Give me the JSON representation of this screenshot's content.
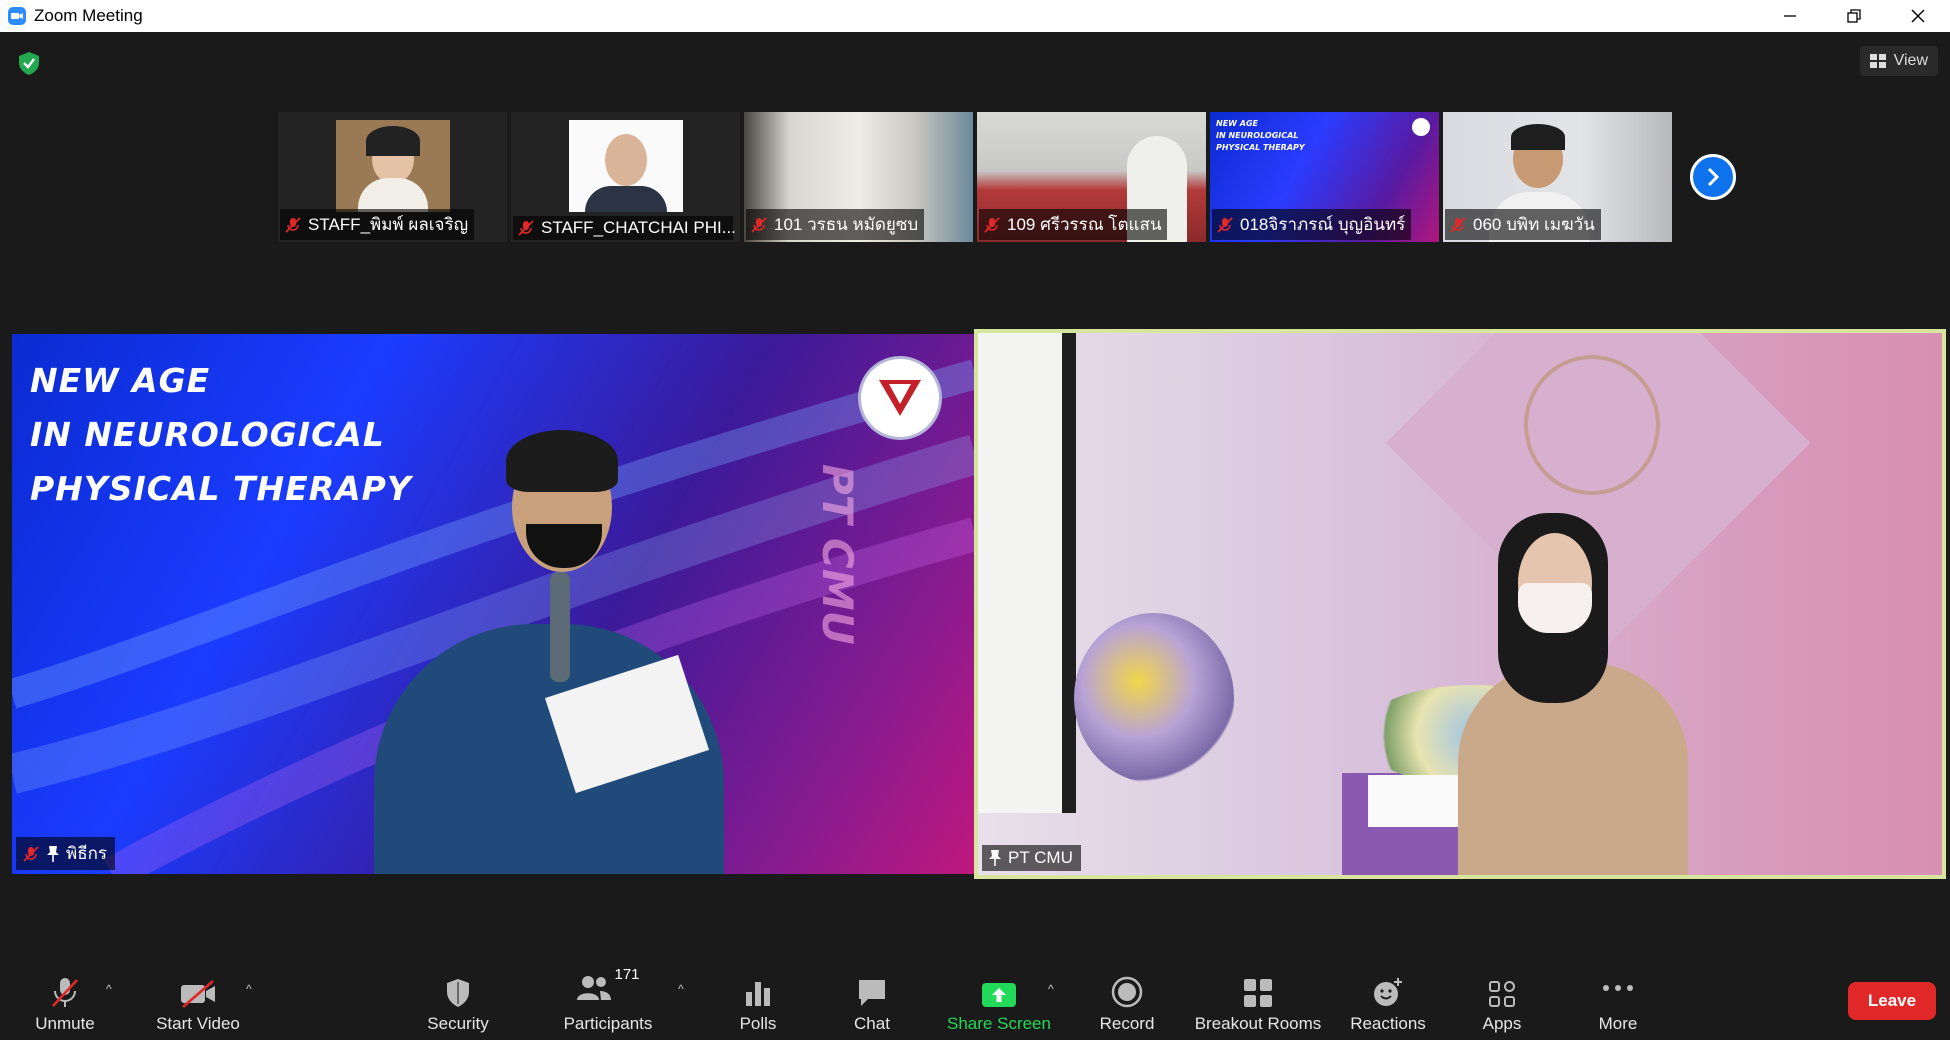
{
  "window": {
    "title": "Zoom Meeting"
  },
  "topbar": {
    "view_label": "View"
  },
  "thumbnails": [
    {
      "name": "STAFF_พิมพ์ ผลเจริญ",
      "muted": true,
      "bg": "#2a2a2a"
    },
    {
      "name": "STAFF_CHATCHAI PHI...",
      "muted": true,
      "bg": "#2a2a2a"
    },
    {
      "name": "101 วรธน หมัดยูซบ",
      "muted": true,
      "bg": "#8c8880"
    },
    {
      "name": "109 ศรีวรรณ โตแสน",
      "muted": true,
      "bg": "#a79a8a"
    },
    {
      "name": "018จิราภรณ์ บุญอินทร์",
      "muted": true,
      "bg": "#1b1f9c"
    },
    {
      "name": "060 บพิท เมฆวัน",
      "muted": true,
      "bg": "#d9dadf"
    }
  ],
  "main": {
    "left": {
      "name": "พิธีกร",
      "slide_lines": [
        "NEW AGE",
        "IN NEUROLOGICAL",
        "PHYSICAL THERAPY"
      ],
      "slide_side_text": "PT CMU"
    },
    "right": {
      "name": "PT CMU"
    }
  },
  "toolbar": {
    "unmute": "Unmute",
    "start_video": "Start Video",
    "security": "Security",
    "participants": "Participants",
    "participants_count": "171",
    "polls": "Polls",
    "chat": "Chat",
    "share_screen": "Share Screen",
    "record": "Record",
    "breakout_rooms": "Breakout Rooms",
    "reactions": "Reactions",
    "apps": "Apps",
    "more": "More",
    "leave": "Leave"
  },
  "colors": {
    "share_screen_green": "#23d959",
    "leave_red": "#e02828",
    "active_speaker_border": "#d8e59c",
    "next_arrow_blue": "#0e72ed"
  }
}
